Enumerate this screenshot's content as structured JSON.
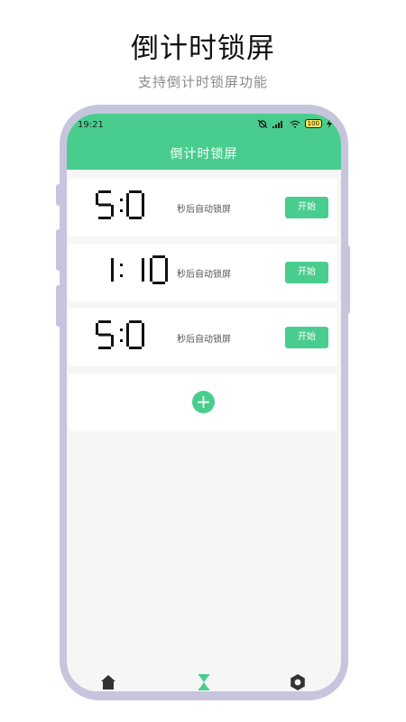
{
  "promo": {
    "title": "倒计时锁屏",
    "subtitle": "支持倒计时锁屏功能"
  },
  "status_bar": {
    "time": "19:21",
    "battery": "100"
  },
  "header": {
    "title": "倒计时锁屏"
  },
  "timers": [
    {
      "time": "5:0",
      "label": "秒后自动锁屏",
      "button": "开始"
    },
    {
      "time": "1:10",
      "label": "秒后自动锁屏",
      "button": "开始"
    },
    {
      "time": "5:0",
      "label": "秒后自动锁屏",
      "button": "开始"
    }
  ],
  "add": {
    "symbol": "+"
  },
  "tabbar": {
    "items": [
      {
        "icon": "home-icon",
        "active": false
      },
      {
        "icon": "hourglass-icon",
        "active": true
      },
      {
        "icon": "settings-icon",
        "active": false
      }
    ]
  },
  "colors": {
    "accent": "#49cd8e",
    "frame": "#c6c5dd",
    "tab_inactive": "#333333"
  }
}
